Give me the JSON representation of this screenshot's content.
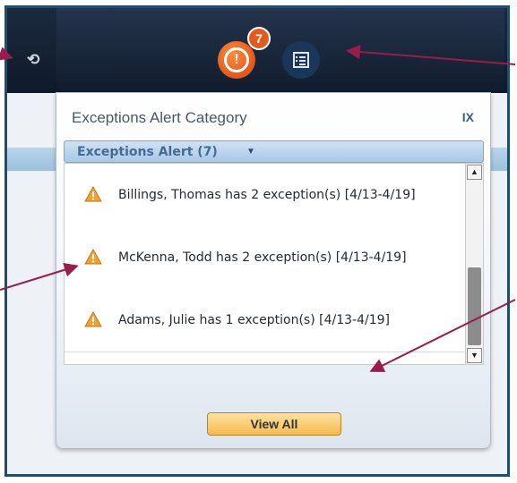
{
  "toolbar": {
    "refresh_icon": "refresh-icon",
    "alert_icon": "exclamation-circle-icon",
    "alert_count": "7",
    "list_icon": "checklist-icon"
  },
  "panel": {
    "title": "Exceptions Alert Category",
    "close_label": "IX",
    "category_label": "Exceptions Alert (7)",
    "items": [
      {
        "text": "Billings, Thomas has 2 exception(s) [4/13-4/19]"
      },
      {
        "text": "McKenna, Todd has 2 exception(s) [4/13-4/19]"
      },
      {
        "text": "Adams, Julie has 1 exception(s) [4/13-4/19]"
      }
    ],
    "view_all_label": "View All"
  },
  "colors": {
    "frame": "#1f4e6e",
    "alert_orange": "#e2571a",
    "annotation_arrow": "#9b1b4a",
    "header_text": "#466a92"
  }
}
